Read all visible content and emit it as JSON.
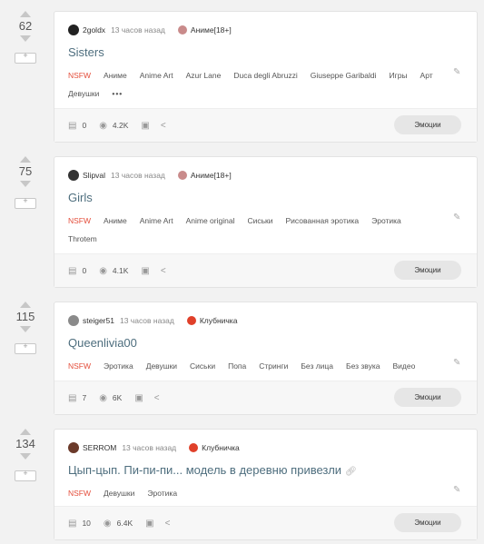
{
  "posts": [
    {
      "rating": "62",
      "author": "2goldx",
      "time": "13 часов назад",
      "community": "Аниме[18+]",
      "community_color": "#c98b8b",
      "avatar_color": "#222222",
      "title": "Sisters",
      "tags": [
        "NSFW",
        "Аниме",
        "Anime Art",
        "Azur Lane",
        "Duca degli Abruzzi",
        "Giuseppe Garibaldi",
        "Игры",
        "Арт",
        "Девушки"
      ],
      "comments": "0",
      "views": "4.2K",
      "emo_label": "Эмоции"
    },
    {
      "rating": "75",
      "author": "Slipval",
      "time": "13 часов назад",
      "community": "Аниме[18+]",
      "community_color": "#c98b8b",
      "avatar_color": "#333333",
      "title": "Girls",
      "tags": [
        "NSFW",
        "Аниме",
        "Anime Art",
        "Anime original",
        "Сиськи",
        "Рисованная эротика",
        "Эротика",
        "Throtem"
      ],
      "comments": "0",
      "views": "4.1K",
      "emo_label": "Эмоции"
    },
    {
      "rating": "115",
      "author": "steiger51",
      "time": "13 часов назад",
      "community": "Клубничка",
      "community_color": "#e0402a",
      "avatar_color": "#8a8a8a",
      "title": "Queenlivia00",
      "tags": [
        "NSFW",
        "Эротика",
        "Девушки",
        "Сиськи",
        "Попа",
        "Стринги",
        "Без лица",
        "Без звука",
        "Видео"
      ],
      "comments": "7",
      "views": "6K",
      "emo_label": "Эмоции"
    },
    {
      "rating": "134",
      "author": "SERROM",
      "time": "13 часов назад",
      "community": "Клубничка",
      "community_color": "#e0402a",
      "avatar_color": "#6b3a2a",
      "title": "Цып-цып. Пи-пи-пи... модель в деревню привезли",
      "tags": [
        "NSFW",
        "Девушки",
        "Эротика"
      ],
      "comments": "10",
      "views": "6.4K",
      "emo_label": "Эмоции"
    }
  ]
}
